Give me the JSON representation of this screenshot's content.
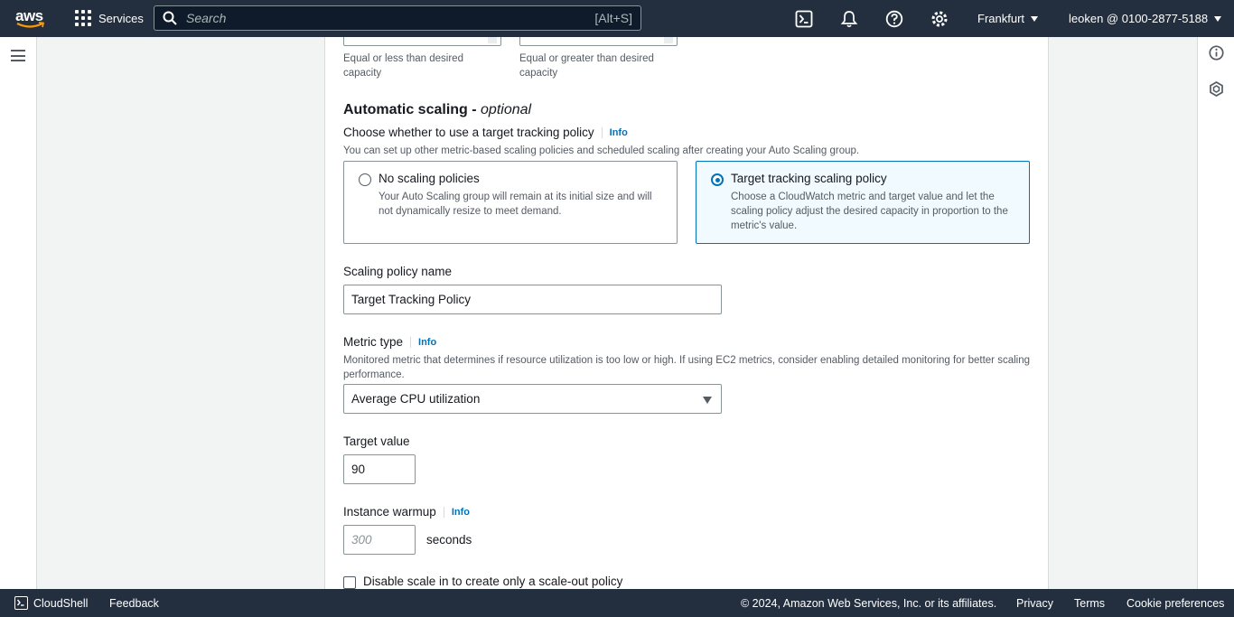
{
  "topnav": {
    "logo_text": "aws",
    "services_label": "Services",
    "search_placeholder": "Search",
    "search_shortcut": "[Alt+S]",
    "region": "Frankfurt",
    "account": "leoken @ 0100-2877-5188",
    "icons": [
      "cloudshell-icon",
      "bell-icon",
      "help-icon",
      "gear-icon"
    ]
  },
  "form": {
    "min_hint": "Equal or less than desired capacity",
    "max_hint": "Equal or greater than desired capacity",
    "section_title": "Automatic scaling -",
    "section_optional": "optional",
    "policy_choice_label": "Choose whether to use a target tracking policy",
    "info": "Info",
    "policy_choice_hint": "You can set up other metric-based scaling policies and scheduled scaling after creating your Auto Scaling group.",
    "options": [
      {
        "title": "No scaling policies",
        "desc": "Your Auto Scaling group will remain at its initial size and will not dynamically resize to meet demand.",
        "selected": false
      },
      {
        "title": "Target tracking scaling policy",
        "desc": "Choose a CloudWatch metric and target value and let the scaling policy adjust the desired capacity in proportion to the metric's value.",
        "selected": true
      }
    ],
    "policy_name_label": "Scaling policy name",
    "policy_name_value": "Target Tracking Policy",
    "metric_type_label": "Metric type",
    "metric_type_hint": "Monitored metric that determines if resource utilization is too low or high. If using EC2 metrics, consider enabling detailed monitoring for better scaling performance.",
    "metric_type_value": "Average CPU utilization",
    "target_value_label": "Target value",
    "target_value": "90",
    "warmup_label": "Instance warmup",
    "warmup_placeholder": "300",
    "warmup_unit": "seconds",
    "disable_scale_in_label": "Disable scale in to create only a scale-out policy"
  },
  "footer": {
    "cloudshell": "CloudShell",
    "feedback": "Feedback",
    "copyright": "© 2024, Amazon Web Services, Inc. or its affiliates.",
    "privacy": "Privacy",
    "terms": "Terms",
    "cookie": "Cookie preferences"
  },
  "colors": {
    "nav_bg": "#232f3e",
    "accent": "#0073bb",
    "page_bg": "#f2f3f3"
  }
}
